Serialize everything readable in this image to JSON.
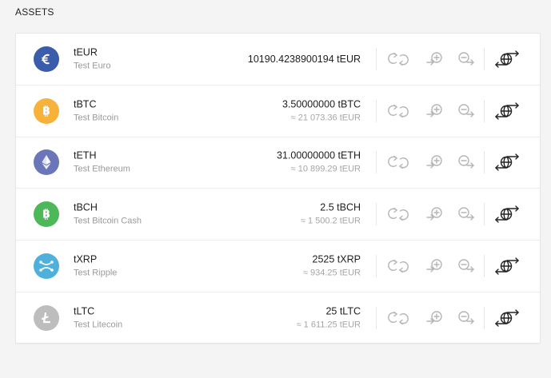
{
  "section": {
    "title": "ASSETS"
  },
  "colors": {
    "euro": "#3a5cab",
    "bitcoin": "#f7b23b",
    "ethereum": "#6b76b8",
    "bitcoin_cash": "#4cb859",
    "ripple": "#4fb1db",
    "litecoin": "#bdbdbd",
    "action_icon": "#b5b5b5",
    "transfer_icon": "#222222"
  },
  "assets": [
    {
      "symbol": "tEUR",
      "name": "Test Euro",
      "balance": "10190.4238900194 tEUR",
      "approx": "",
      "icon": "euro-icon"
    },
    {
      "symbol": "tBTC",
      "name": "Test Bitcoin",
      "balance": "3.50000000 tBTC",
      "approx": "≈ 21 073.36 tEUR",
      "icon": "bitcoin-icon"
    },
    {
      "symbol": "tETH",
      "name": "Test Ethereum",
      "balance": "31.00000000 tETH",
      "approx": "≈ 10 899.29 tEUR",
      "icon": "ethereum-icon"
    },
    {
      "symbol": "tBCH",
      "name": "Test Bitcoin Cash",
      "balance": "2.5 tBCH",
      "approx": "≈ 1 500.2 tEUR",
      "icon": "bitcoin-cash-icon"
    },
    {
      "symbol": "tXRP",
      "name": "Test Ripple",
      "balance": "2525 tXRP",
      "approx": "≈ 934.25 tEUR",
      "icon": "ripple-icon"
    },
    {
      "symbol": "tLTC",
      "name": "Test Litecoin",
      "balance": "25 tLTC",
      "approx": "≈ 1 611.25 tEUR",
      "icon": "litecoin-icon"
    }
  ],
  "actions": [
    "exchange-icon",
    "deposit-icon",
    "withdraw-icon",
    "transfer-icon"
  ]
}
